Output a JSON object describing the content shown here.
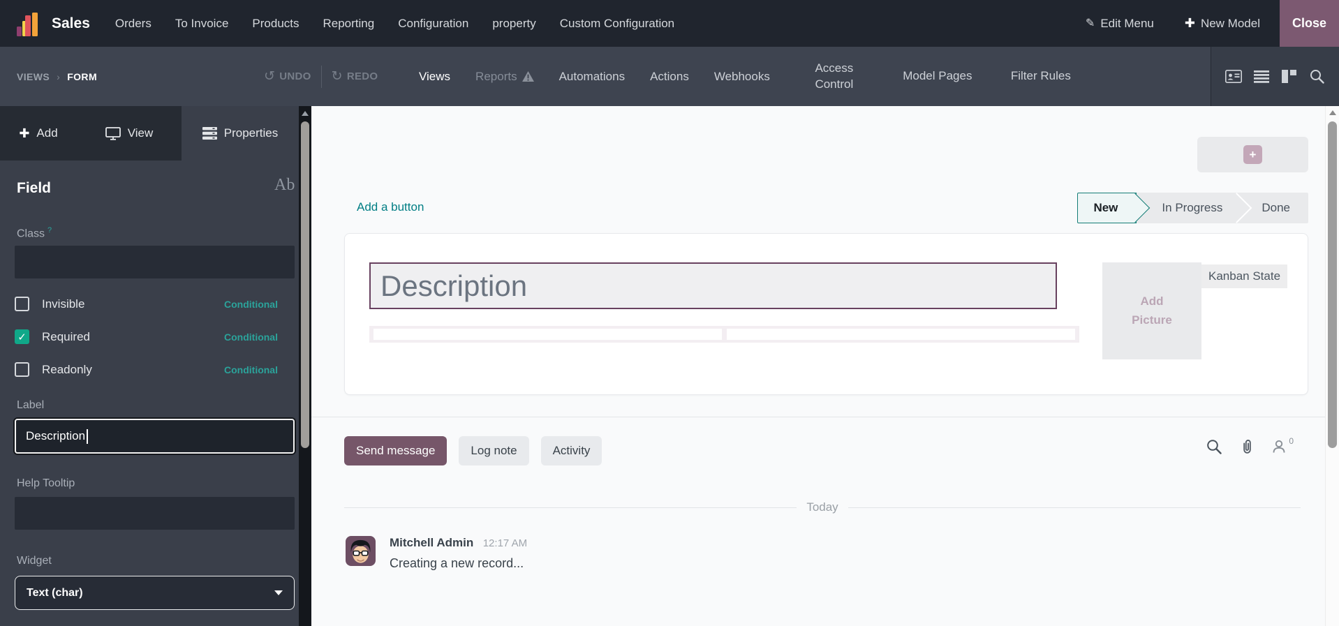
{
  "topbar": {
    "app_name": "Sales",
    "menus": [
      "Orders",
      "To Invoice",
      "Products",
      "Reporting",
      "Configuration",
      "property",
      "Custom Configuration"
    ],
    "edit_menu_label": "Edit Menu",
    "new_model_label": "New Model",
    "close_label": "Close"
  },
  "studio_bar": {
    "breadcrumb": {
      "root": "VIEWS",
      "separator": "›",
      "current": "FORM"
    },
    "undo_label": "UNDO",
    "redo_label": "REDO",
    "tabs": [
      {
        "label": "Views",
        "state": "active"
      },
      {
        "label": "Reports",
        "state": "disabled-warning"
      },
      {
        "label": "Automations",
        "state": "normal"
      },
      {
        "label": "Actions",
        "state": "normal"
      },
      {
        "label": "Webhooks",
        "state": "normal"
      },
      {
        "label": "Access Control",
        "state": "normal"
      },
      {
        "label": "Model Pages",
        "state": "normal"
      },
      {
        "label": "Filter Rules",
        "state": "normal"
      }
    ]
  },
  "sidebar": {
    "tabs": [
      {
        "label": "Add"
      },
      {
        "label": "View"
      },
      {
        "label": "Properties",
        "active": true
      }
    ],
    "panel_title": "Field",
    "field_type_badge": "Ab",
    "class_label": "Class",
    "class_hint": "?",
    "class_value": "",
    "checkbox_rows": [
      {
        "label": "Invisible",
        "checked": false,
        "link_label": "Conditional"
      },
      {
        "label": "Required",
        "checked": true,
        "link_label": "Conditional"
      },
      {
        "label": "Readonly",
        "checked": false,
        "link_label": "Conditional"
      }
    ],
    "check_glyph": "✓",
    "label_label": "Label",
    "label_value": "Description",
    "help_label": "Help Tooltip",
    "help_value": "",
    "widget_label": "Widget",
    "widget_value": "Text (char)"
  },
  "canvas": {
    "add_button_label": "Add a button",
    "plus_glyph": "+",
    "statusbar": [
      {
        "label": "New",
        "active": true
      },
      {
        "label": "In Progress",
        "active": false
      },
      {
        "label": "Done",
        "active": false
      }
    ],
    "description_field_text": "Description",
    "add_picture_label": "Add Picture",
    "kanban_state_label": "Kanban State"
  },
  "chatter": {
    "send_message_label": "Send message",
    "log_note_label": "Log note",
    "activity_label": "Activity",
    "follower_count": "0",
    "date_divider": "Today",
    "messages": [
      {
        "author": "Mitchell Admin",
        "time": "12:17 AM",
        "text": "Creating a new record..."
      }
    ]
  },
  "colors": {
    "accent_teal": "#017e84",
    "brand_chatter_purple": "#765669",
    "close_button_bg": "#7c5971",
    "checkbox_checked": "#10a889",
    "selected_field_border": "#68415f",
    "topbar_bg": "#20252e",
    "studiobar_bg": "#3e4450",
    "sidebar_bg": "#3a3f4a"
  }
}
